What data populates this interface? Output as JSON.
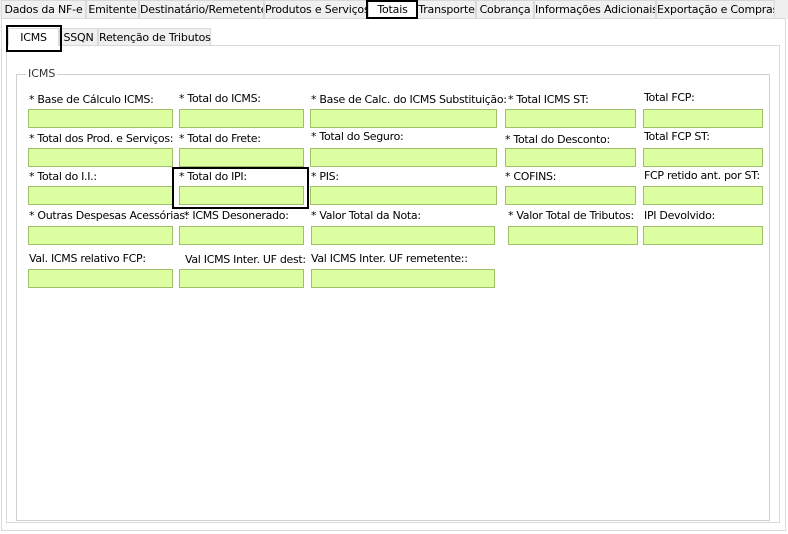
{
  "tabs": [
    {
      "label": "Dados da NF-e"
    },
    {
      "label": "Emitente"
    },
    {
      "label": "Destinatário/Remetente"
    },
    {
      "label": "Produtos e Serviços"
    },
    {
      "label": "Totais"
    },
    {
      "label": "Transporte"
    },
    {
      "label": "Cobrança"
    },
    {
      "label": "Informações Adicionais"
    },
    {
      "label": "Exportação e Compras"
    }
  ],
  "subtabs": [
    {
      "label": "ICMS"
    },
    {
      "label": "SSQN"
    },
    {
      "label": "Retenção de Tributos"
    }
  ],
  "group": {
    "title": "ICMS"
  },
  "fields": {
    "base_calculo_icms": {
      "label": "* Base de Cálculo ICMS:",
      "value": ""
    },
    "total_icms": {
      "label": "* Total do ICMS:",
      "value": ""
    },
    "base_calc_icms_st": {
      "label": "* Base de Calc. do ICMS Substituição:",
      "value": ""
    },
    "total_icms_st": {
      "label": "* Total ICMS ST:",
      "value": ""
    },
    "total_fcp": {
      "label": "Total FCP:",
      "value": ""
    },
    "total_prod_servicos": {
      "label": "* Total dos Prod. e Serviços:",
      "value": ""
    },
    "total_frete": {
      "label": "* Total do Frete:",
      "value": ""
    },
    "total_seguro": {
      "label": "* Total do Seguro:",
      "value": ""
    },
    "total_desconto": {
      "label": "* Total do Desconto:",
      "value": ""
    },
    "total_fcp_st": {
      "label": "Total FCP ST:",
      "value": ""
    },
    "total_ii": {
      "label": "* Total do I.I.:",
      "value": ""
    },
    "total_ipi": {
      "label": "* Total do IPI:",
      "value": ""
    },
    "pis": {
      "label": "* PIS:",
      "value": ""
    },
    "cofins": {
      "label": "* COFINS:",
      "value": ""
    },
    "fcp_retido_st": {
      "label": "FCP retido ant. por ST:",
      "value": ""
    },
    "outras_despesas": {
      "label": "* Outras Despesas Acessórias:",
      "value": ""
    },
    "icms_desonerado": {
      "label": "* ICMS Desonerado:",
      "value": ""
    },
    "valor_total_nota": {
      "label": "* Valor Total da Nota:",
      "value": ""
    },
    "valor_total_tributos": {
      "label": "* Valor Total de Tributos:",
      "value": ""
    },
    "ipi_devolvido": {
      "label": "IPI Devolvido:",
      "value": ""
    },
    "val_icms_fcp": {
      "label": "Val. ICMS relativo FCP:",
      "value": ""
    },
    "val_icms_uf_dest": {
      "label": "Val ICMS Inter. UF dest:",
      "value": ""
    },
    "val_icms_uf_remetente": {
      "label": "Val ICMS Inter. UF remetente::",
      "value": ""
    }
  }
}
